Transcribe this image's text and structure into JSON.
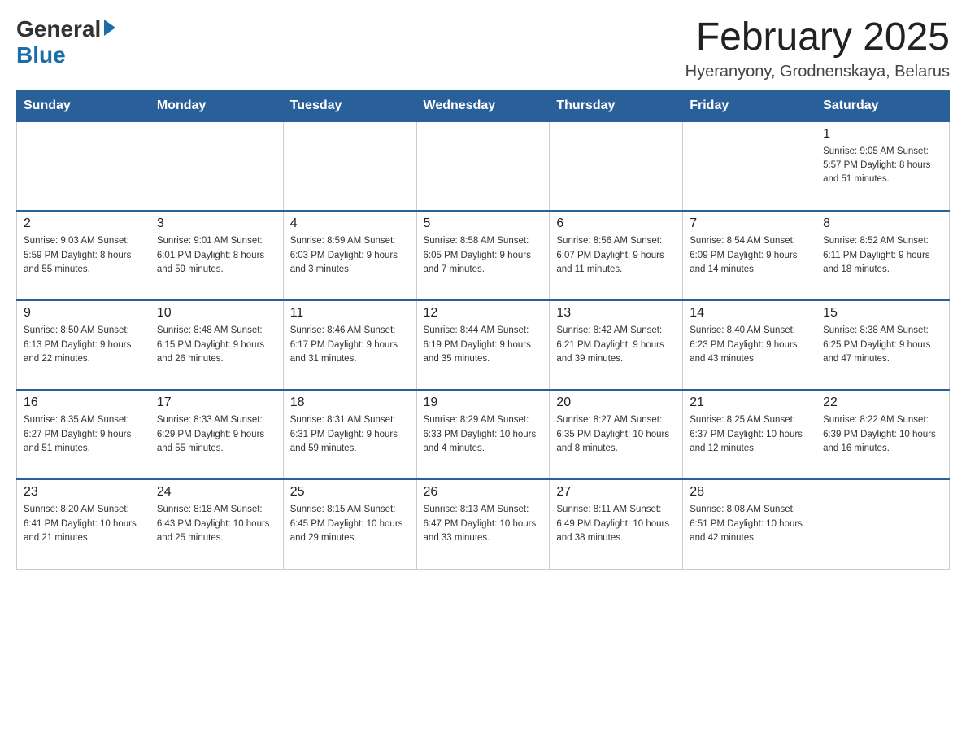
{
  "logo": {
    "general": "General",
    "blue": "Blue"
  },
  "header": {
    "title": "February 2025",
    "subtitle": "Hyeranyony, Grodnenskaya, Belarus"
  },
  "days_of_week": [
    "Sunday",
    "Monday",
    "Tuesday",
    "Wednesday",
    "Thursday",
    "Friday",
    "Saturday"
  ],
  "weeks": [
    [
      {
        "day": "",
        "info": ""
      },
      {
        "day": "",
        "info": ""
      },
      {
        "day": "",
        "info": ""
      },
      {
        "day": "",
        "info": ""
      },
      {
        "day": "",
        "info": ""
      },
      {
        "day": "",
        "info": ""
      },
      {
        "day": "1",
        "info": "Sunrise: 9:05 AM\nSunset: 5:57 PM\nDaylight: 8 hours and 51 minutes."
      }
    ],
    [
      {
        "day": "2",
        "info": "Sunrise: 9:03 AM\nSunset: 5:59 PM\nDaylight: 8 hours and 55 minutes."
      },
      {
        "day": "3",
        "info": "Sunrise: 9:01 AM\nSunset: 6:01 PM\nDaylight: 8 hours and 59 minutes."
      },
      {
        "day": "4",
        "info": "Sunrise: 8:59 AM\nSunset: 6:03 PM\nDaylight: 9 hours and 3 minutes."
      },
      {
        "day": "5",
        "info": "Sunrise: 8:58 AM\nSunset: 6:05 PM\nDaylight: 9 hours and 7 minutes."
      },
      {
        "day": "6",
        "info": "Sunrise: 8:56 AM\nSunset: 6:07 PM\nDaylight: 9 hours and 11 minutes."
      },
      {
        "day": "7",
        "info": "Sunrise: 8:54 AM\nSunset: 6:09 PM\nDaylight: 9 hours and 14 minutes."
      },
      {
        "day": "8",
        "info": "Sunrise: 8:52 AM\nSunset: 6:11 PM\nDaylight: 9 hours and 18 minutes."
      }
    ],
    [
      {
        "day": "9",
        "info": "Sunrise: 8:50 AM\nSunset: 6:13 PM\nDaylight: 9 hours and 22 minutes."
      },
      {
        "day": "10",
        "info": "Sunrise: 8:48 AM\nSunset: 6:15 PM\nDaylight: 9 hours and 26 minutes."
      },
      {
        "day": "11",
        "info": "Sunrise: 8:46 AM\nSunset: 6:17 PM\nDaylight: 9 hours and 31 minutes."
      },
      {
        "day": "12",
        "info": "Sunrise: 8:44 AM\nSunset: 6:19 PM\nDaylight: 9 hours and 35 minutes."
      },
      {
        "day": "13",
        "info": "Sunrise: 8:42 AM\nSunset: 6:21 PM\nDaylight: 9 hours and 39 minutes."
      },
      {
        "day": "14",
        "info": "Sunrise: 8:40 AM\nSunset: 6:23 PM\nDaylight: 9 hours and 43 minutes."
      },
      {
        "day": "15",
        "info": "Sunrise: 8:38 AM\nSunset: 6:25 PM\nDaylight: 9 hours and 47 minutes."
      }
    ],
    [
      {
        "day": "16",
        "info": "Sunrise: 8:35 AM\nSunset: 6:27 PM\nDaylight: 9 hours and 51 minutes."
      },
      {
        "day": "17",
        "info": "Sunrise: 8:33 AM\nSunset: 6:29 PM\nDaylight: 9 hours and 55 minutes."
      },
      {
        "day": "18",
        "info": "Sunrise: 8:31 AM\nSunset: 6:31 PM\nDaylight: 9 hours and 59 minutes."
      },
      {
        "day": "19",
        "info": "Sunrise: 8:29 AM\nSunset: 6:33 PM\nDaylight: 10 hours and 4 minutes."
      },
      {
        "day": "20",
        "info": "Sunrise: 8:27 AM\nSunset: 6:35 PM\nDaylight: 10 hours and 8 minutes."
      },
      {
        "day": "21",
        "info": "Sunrise: 8:25 AM\nSunset: 6:37 PM\nDaylight: 10 hours and 12 minutes."
      },
      {
        "day": "22",
        "info": "Sunrise: 8:22 AM\nSunset: 6:39 PM\nDaylight: 10 hours and 16 minutes."
      }
    ],
    [
      {
        "day": "23",
        "info": "Sunrise: 8:20 AM\nSunset: 6:41 PM\nDaylight: 10 hours and 21 minutes."
      },
      {
        "day": "24",
        "info": "Sunrise: 8:18 AM\nSunset: 6:43 PM\nDaylight: 10 hours and 25 minutes."
      },
      {
        "day": "25",
        "info": "Sunrise: 8:15 AM\nSunset: 6:45 PM\nDaylight: 10 hours and 29 minutes."
      },
      {
        "day": "26",
        "info": "Sunrise: 8:13 AM\nSunset: 6:47 PM\nDaylight: 10 hours and 33 minutes."
      },
      {
        "day": "27",
        "info": "Sunrise: 8:11 AM\nSunset: 6:49 PM\nDaylight: 10 hours and 38 minutes."
      },
      {
        "day": "28",
        "info": "Sunrise: 8:08 AM\nSunset: 6:51 PM\nDaylight: 10 hours and 42 minutes."
      },
      {
        "day": "",
        "info": ""
      }
    ]
  ]
}
